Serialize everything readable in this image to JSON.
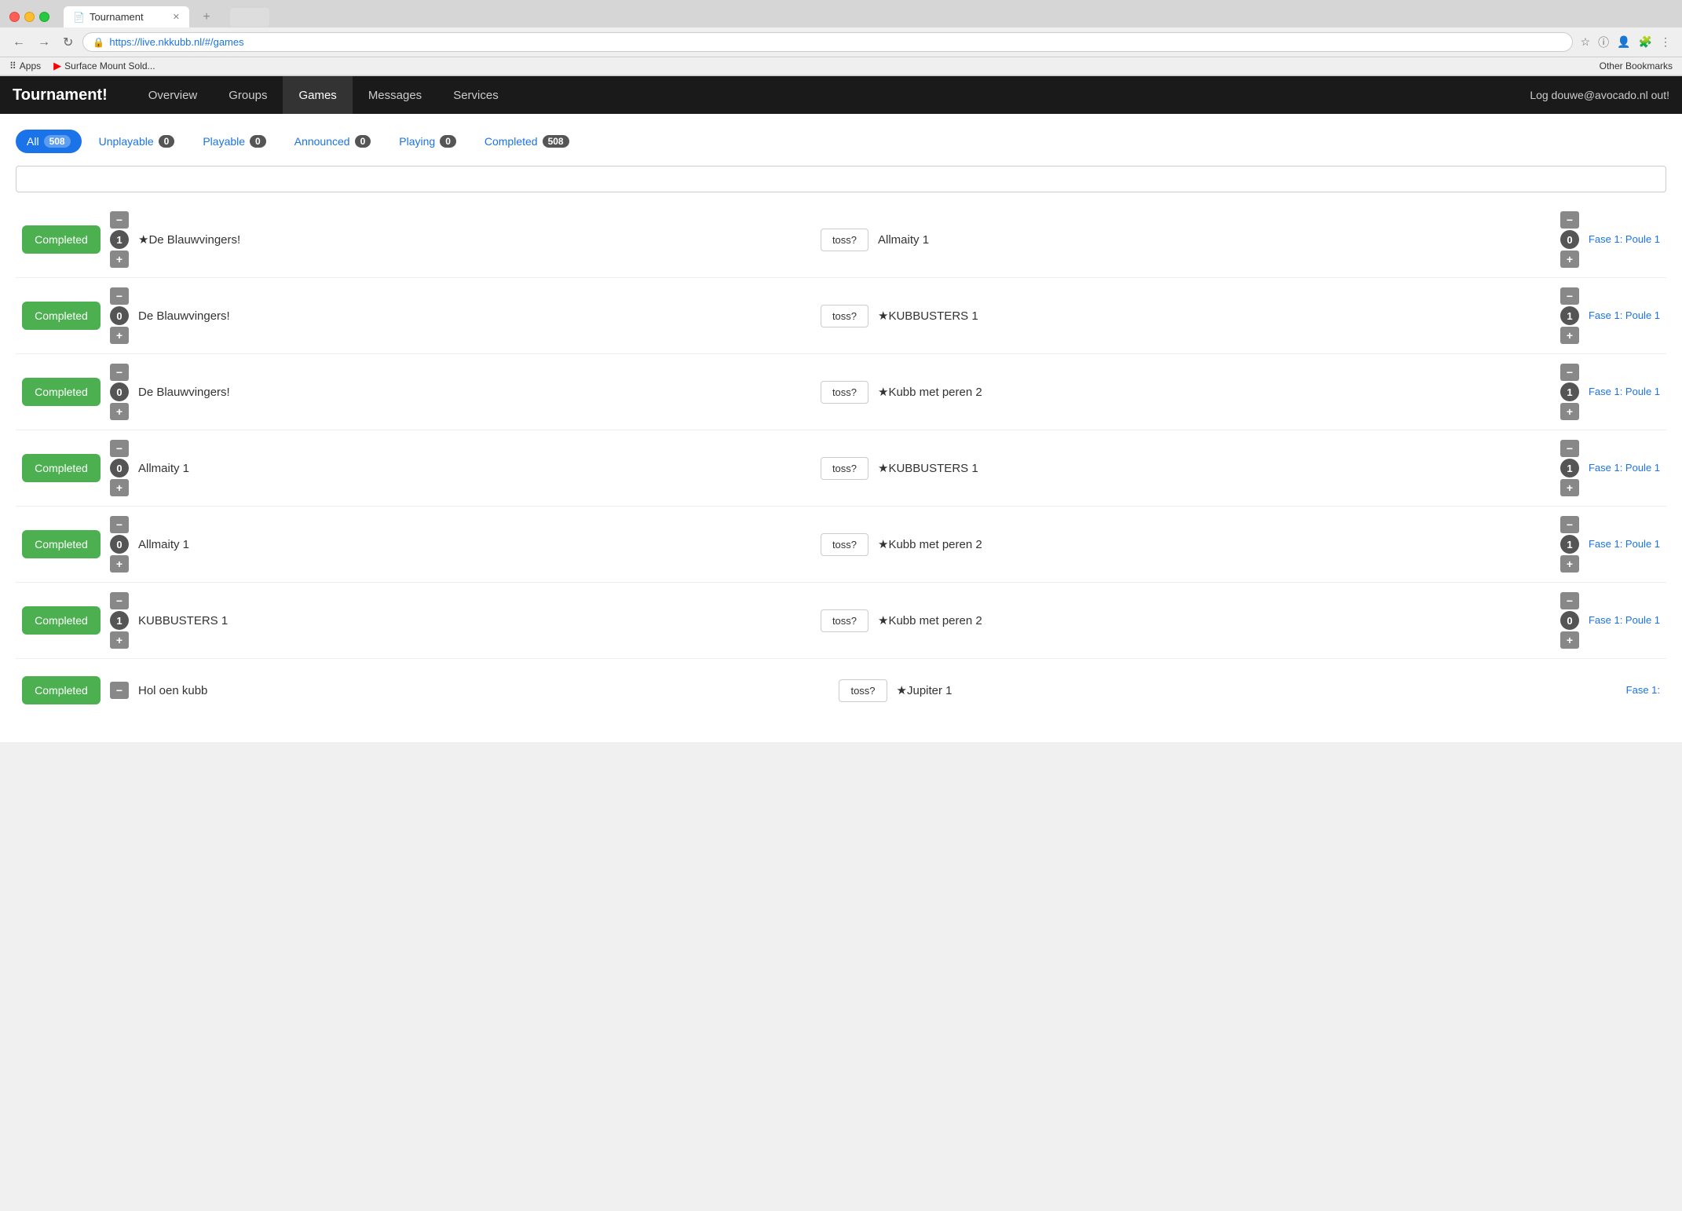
{
  "browser": {
    "tab_title": "Tournament",
    "url": "https://live.nkkubb.nl/#/games",
    "bookmarks": [
      {
        "label": "Apps",
        "icon": "grid"
      },
      {
        "label": "Surface Mount Sold...",
        "icon": "youtube"
      }
    ],
    "bookmarks_right": "Other Bookmarks"
  },
  "nav": {
    "brand": "Tournament!",
    "links": [
      "Overview",
      "Groups",
      "Games",
      "Messages",
      "Services"
    ],
    "active_link": "Games",
    "logout": "Log douwe@avocado.nl out!"
  },
  "filters": [
    {
      "label": "All",
      "badge": "508",
      "active": true
    },
    {
      "label": "Unplayable",
      "badge": "0",
      "active": false
    },
    {
      "label": "Playable",
      "badge": "0",
      "active": false
    },
    {
      "label": "Announced",
      "badge": "0",
      "active": false
    },
    {
      "label": "Playing",
      "badge": "0",
      "active": false
    },
    {
      "label": "Completed",
      "badge": "508",
      "active": false
    }
  ],
  "search_placeholder": "",
  "games": [
    {
      "status": "Completed",
      "team1": "★De Blauwvingers!",
      "score1": "1",
      "toss": "toss?",
      "team2": "Allmaity 1",
      "score2": "0",
      "phase": "Fase 1: Poule 1"
    },
    {
      "status": "Completed",
      "team1": "De Blauwvingers!",
      "score1": "0",
      "toss": "toss?",
      "team2": "★KUBBUSTERS 1",
      "score2": "1",
      "phase": "Fase 1: Poule 1"
    },
    {
      "status": "Completed",
      "team1": "De Blauwvingers!",
      "score1": "0",
      "toss": "toss?",
      "team2": "★Kubb met peren 2",
      "score2": "1",
      "phase": "Fase 1: Poule 1"
    },
    {
      "status": "Completed",
      "team1": "Allmaity 1",
      "score1": "0",
      "toss": "toss?",
      "team2": "★KUBBUSTERS 1",
      "score2": "1",
      "phase": "Fase 1: Poule 1"
    },
    {
      "status": "Completed",
      "team1": "Allmaity 1",
      "score1": "0",
      "toss": "toss?",
      "team2": "★Kubb met peren 2",
      "score2": "1",
      "phase": "Fase 1: Poule 1"
    },
    {
      "status": "Completed",
      "team1": "KUBBUSTERS 1",
      "score1": "1",
      "toss": "toss?",
      "team2": "★Kubb met peren 2",
      "score2": "0",
      "phase": "Fase 1: Poule 1"
    },
    {
      "status": "Completed",
      "team1": "Hol oen kubb",
      "score1": "–",
      "toss": "toss?",
      "team2": "★Jupiter 1",
      "score2": "–",
      "phase": "Fase 1:"
    }
  ]
}
